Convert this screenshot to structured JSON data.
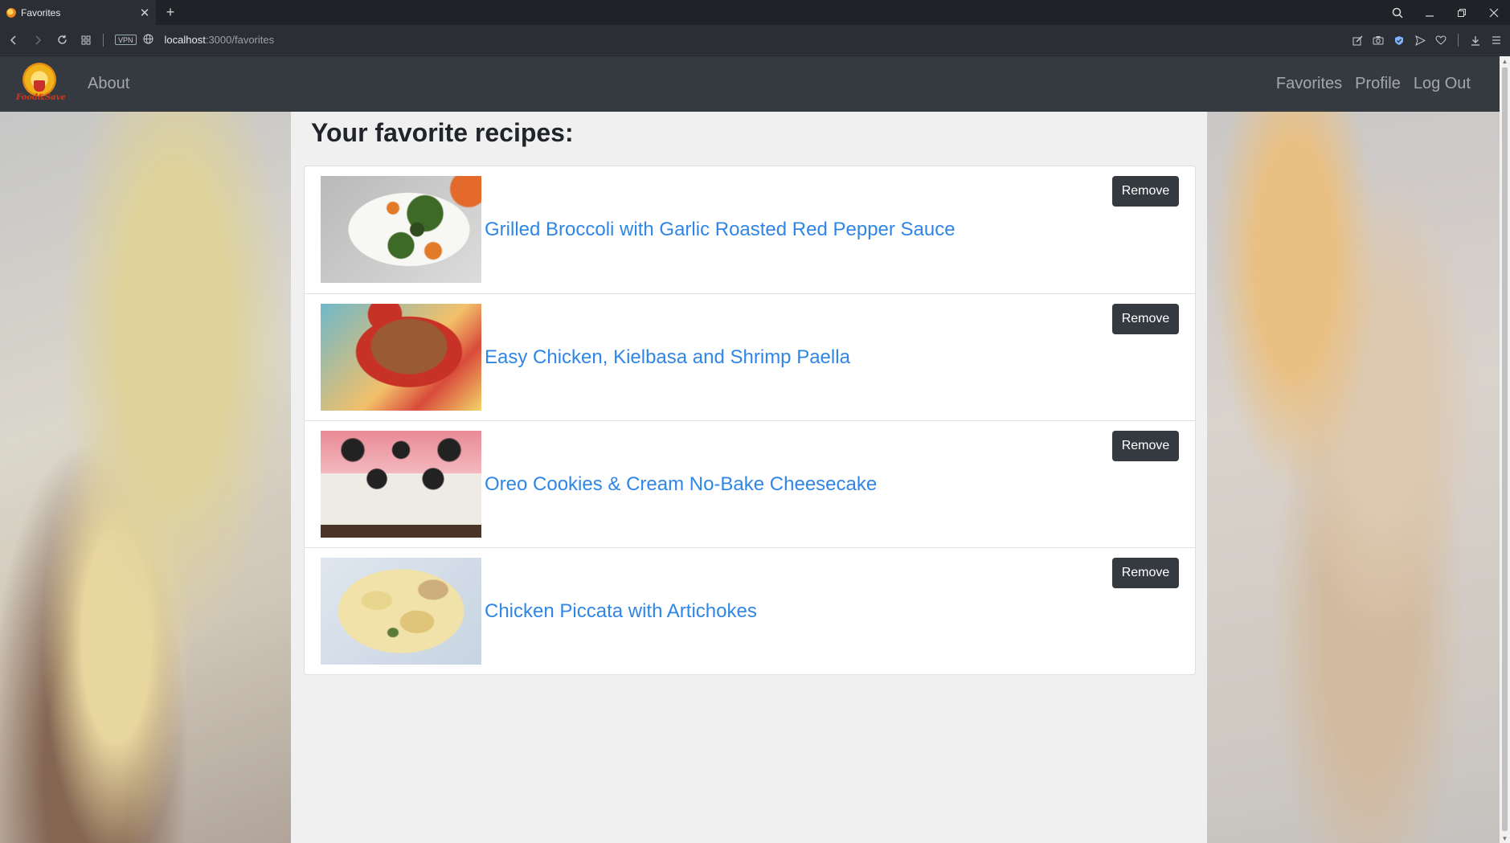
{
  "browser": {
    "tab_title": "Favorites",
    "tab_close_glyph": "✕",
    "new_tab_glyph": "+",
    "vpn_label": "VPN",
    "url_host": "localhost",
    "url_rest": ":3000/favorites"
  },
  "navbar": {
    "brand_text": "Food&Save",
    "about_label": "About",
    "favorites_label": "Favorites",
    "profile_label": "Profile",
    "logout_label": "Log Out"
  },
  "page": {
    "heading": "Your favorite recipes:",
    "remove_label": "Remove",
    "recipes": [
      {
        "title": "Grilled Broccoli with Garlic Roasted Red Pepper Sauce"
      },
      {
        "title": "Easy Chicken, Kielbasa and Shrimp Paella"
      },
      {
        "title": "Oreo Cookies & Cream No-Bake Cheesecake"
      },
      {
        "title": "Chicken Piccata with Artichokes"
      }
    ]
  },
  "colors": {
    "navbar_bg": "#343a40",
    "link": "#2f86e6",
    "button_bg": "#343a40",
    "container_bg": "#f0f0f0"
  }
}
